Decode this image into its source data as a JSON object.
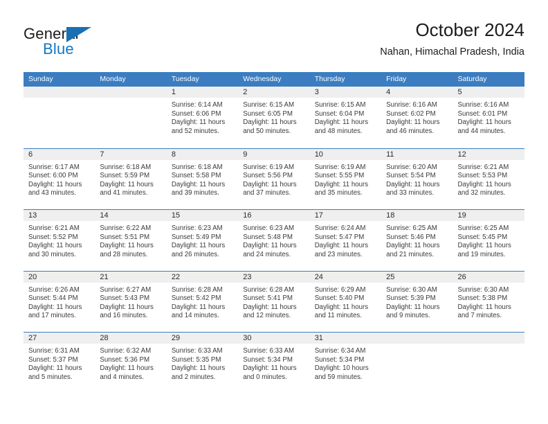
{
  "brand": {
    "word_one": "General",
    "word_two": "Blue",
    "flag_icon": "triangle-flag-icon"
  },
  "header": {
    "title": "October 2024",
    "location": "Nahan, Himachal Pradesh, India"
  },
  "colors": {
    "header_bar": "#3b7dc0",
    "brand_blue": "#1277c4",
    "day_band": "#efefef",
    "text": "#222222"
  },
  "calendar": {
    "weekday_headers": [
      "Sunday",
      "Monday",
      "Tuesday",
      "Wednesday",
      "Thursday",
      "Friday",
      "Saturday"
    ],
    "labels": {
      "sunrise_prefix": "Sunrise:",
      "sunset_prefix": "Sunset:",
      "daylight_prefix": "Daylight:"
    },
    "weeks": [
      [
        {
          "day": "",
          "empty": true
        },
        {
          "day": "",
          "empty": true
        },
        {
          "day": "1",
          "sunrise": "Sunrise: 6:14 AM",
          "sunset": "Sunset: 6:06 PM",
          "daylight1": "Daylight: 11 hours",
          "daylight2": "and 52 minutes."
        },
        {
          "day": "2",
          "sunrise": "Sunrise: 6:15 AM",
          "sunset": "Sunset: 6:05 PM",
          "daylight1": "Daylight: 11 hours",
          "daylight2": "and 50 minutes."
        },
        {
          "day": "3",
          "sunrise": "Sunrise: 6:15 AM",
          "sunset": "Sunset: 6:04 PM",
          "daylight1": "Daylight: 11 hours",
          "daylight2": "and 48 minutes."
        },
        {
          "day": "4",
          "sunrise": "Sunrise: 6:16 AM",
          "sunset": "Sunset: 6:02 PM",
          "daylight1": "Daylight: 11 hours",
          "daylight2": "and 46 minutes."
        },
        {
          "day": "5",
          "sunrise": "Sunrise: 6:16 AM",
          "sunset": "Sunset: 6:01 PM",
          "daylight1": "Daylight: 11 hours",
          "daylight2": "and 44 minutes."
        }
      ],
      [
        {
          "day": "6",
          "sunrise": "Sunrise: 6:17 AM",
          "sunset": "Sunset: 6:00 PM",
          "daylight1": "Daylight: 11 hours",
          "daylight2": "and 43 minutes."
        },
        {
          "day": "7",
          "sunrise": "Sunrise: 6:18 AM",
          "sunset": "Sunset: 5:59 PM",
          "daylight1": "Daylight: 11 hours",
          "daylight2": "and 41 minutes."
        },
        {
          "day": "8",
          "sunrise": "Sunrise: 6:18 AM",
          "sunset": "Sunset: 5:58 PM",
          "daylight1": "Daylight: 11 hours",
          "daylight2": "and 39 minutes."
        },
        {
          "day": "9",
          "sunrise": "Sunrise: 6:19 AM",
          "sunset": "Sunset: 5:56 PM",
          "daylight1": "Daylight: 11 hours",
          "daylight2": "and 37 minutes."
        },
        {
          "day": "10",
          "sunrise": "Sunrise: 6:19 AM",
          "sunset": "Sunset: 5:55 PM",
          "daylight1": "Daylight: 11 hours",
          "daylight2": "and 35 minutes."
        },
        {
          "day": "11",
          "sunrise": "Sunrise: 6:20 AM",
          "sunset": "Sunset: 5:54 PM",
          "daylight1": "Daylight: 11 hours",
          "daylight2": "and 33 minutes."
        },
        {
          "day": "12",
          "sunrise": "Sunrise: 6:21 AM",
          "sunset": "Sunset: 5:53 PM",
          "daylight1": "Daylight: 11 hours",
          "daylight2": "and 32 minutes."
        }
      ],
      [
        {
          "day": "13",
          "sunrise": "Sunrise: 6:21 AM",
          "sunset": "Sunset: 5:52 PM",
          "daylight1": "Daylight: 11 hours",
          "daylight2": "and 30 minutes."
        },
        {
          "day": "14",
          "sunrise": "Sunrise: 6:22 AM",
          "sunset": "Sunset: 5:51 PM",
          "daylight1": "Daylight: 11 hours",
          "daylight2": "and 28 minutes."
        },
        {
          "day": "15",
          "sunrise": "Sunrise: 6:23 AM",
          "sunset": "Sunset: 5:49 PM",
          "daylight1": "Daylight: 11 hours",
          "daylight2": "and 26 minutes."
        },
        {
          "day": "16",
          "sunrise": "Sunrise: 6:23 AM",
          "sunset": "Sunset: 5:48 PM",
          "daylight1": "Daylight: 11 hours",
          "daylight2": "and 24 minutes."
        },
        {
          "day": "17",
          "sunrise": "Sunrise: 6:24 AM",
          "sunset": "Sunset: 5:47 PM",
          "daylight1": "Daylight: 11 hours",
          "daylight2": "and 23 minutes."
        },
        {
          "day": "18",
          "sunrise": "Sunrise: 6:25 AM",
          "sunset": "Sunset: 5:46 PM",
          "daylight1": "Daylight: 11 hours",
          "daylight2": "and 21 minutes."
        },
        {
          "day": "19",
          "sunrise": "Sunrise: 6:25 AM",
          "sunset": "Sunset: 5:45 PM",
          "daylight1": "Daylight: 11 hours",
          "daylight2": "and 19 minutes."
        }
      ],
      [
        {
          "day": "20",
          "sunrise": "Sunrise: 6:26 AM",
          "sunset": "Sunset: 5:44 PM",
          "daylight1": "Daylight: 11 hours",
          "daylight2": "and 17 minutes."
        },
        {
          "day": "21",
          "sunrise": "Sunrise: 6:27 AM",
          "sunset": "Sunset: 5:43 PM",
          "daylight1": "Daylight: 11 hours",
          "daylight2": "and 16 minutes."
        },
        {
          "day": "22",
          "sunrise": "Sunrise: 6:28 AM",
          "sunset": "Sunset: 5:42 PM",
          "daylight1": "Daylight: 11 hours",
          "daylight2": "and 14 minutes."
        },
        {
          "day": "23",
          "sunrise": "Sunrise: 6:28 AM",
          "sunset": "Sunset: 5:41 PM",
          "daylight1": "Daylight: 11 hours",
          "daylight2": "and 12 minutes."
        },
        {
          "day": "24",
          "sunrise": "Sunrise: 6:29 AM",
          "sunset": "Sunset: 5:40 PM",
          "daylight1": "Daylight: 11 hours",
          "daylight2": "and 11 minutes."
        },
        {
          "day": "25",
          "sunrise": "Sunrise: 6:30 AM",
          "sunset": "Sunset: 5:39 PM",
          "daylight1": "Daylight: 11 hours",
          "daylight2": "and 9 minutes."
        },
        {
          "day": "26",
          "sunrise": "Sunrise: 6:30 AM",
          "sunset": "Sunset: 5:38 PM",
          "daylight1": "Daylight: 11 hours",
          "daylight2": "and 7 minutes."
        }
      ],
      [
        {
          "day": "27",
          "sunrise": "Sunrise: 6:31 AM",
          "sunset": "Sunset: 5:37 PM",
          "daylight1": "Daylight: 11 hours",
          "daylight2": "and 5 minutes."
        },
        {
          "day": "28",
          "sunrise": "Sunrise: 6:32 AM",
          "sunset": "Sunset: 5:36 PM",
          "daylight1": "Daylight: 11 hours",
          "daylight2": "and 4 minutes."
        },
        {
          "day": "29",
          "sunrise": "Sunrise: 6:33 AM",
          "sunset": "Sunset: 5:35 PM",
          "daylight1": "Daylight: 11 hours",
          "daylight2": "and 2 minutes."
        },
        {
          "day": "30",
          "sunrise": "Sunrise: 6:33 AM",
          "sunset": "Sunset: 5:34 PM",
          "daylight1": "Daylight: 11 hours",
          "daylight2": "and 0 minutes."
        },
        {
          "day": "31",
          "sunrise": "Sunrise: 6:34 AM",
          "sunset": "Sunset: 5:34 PM",
          "daylight1": "Daylight: 10 hours",
          "daylight2": "and 59 minutes."
        },
        {
          "day": "",
          "empty": true
        },
        {
          "day": "",
          "empty": true
        }
      ]
    ]
  }
}
